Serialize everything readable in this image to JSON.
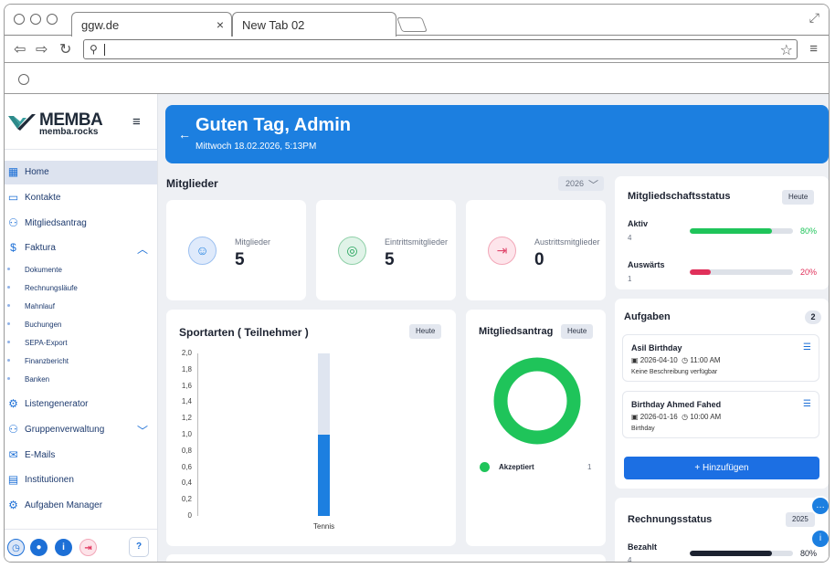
{
  "browser": {
    "tabs": [
      {
        "label": "ggw.de",
        "close": "×"
      },
      {
        "label": "New Tab 02"
      }
    ],
    "url": ""
  },
  "sidebar": {
    "logo_name": "MEMBA",
    "logo_sub": "memba.rocks",
    "items": [
      {
        "label": "Home",
        "icon": "grid-icon"
      },
      {
        "label": "Kontakte",
        "icon": "contact-card-icon"
      },
      {
        "label": "Mitgliedsantrag",
        "icon": "user-add-icon"
      },
      {
        "label": "Faktura",
        "icon": "dollar-icon"
      },
      {
        "label": "Listengenerator",
        "icon": "list-generator-icon"
      },
      {
        "label": "Gruppenverwaltung",
        "icon": "group-icon"
      },
      {
        "label": "E-Mails",
        "icon": "mail-icon"
      },
      {
        "label": "Institutionen",
        "icon": "institution-icon"
      },
      {
        "label": "Aufgaben Manager",
        "icon": "gear-icon"
      }
    ],
    "faktura_sub": [
      "Dokumente",
      "Rechnungsläufe",
      "Mahnlauf",
      "Buchungen",
      "SEPA-Export",
      "Finanzbericht",
      "Banken"
    ]
  },
  "header": {
    "title": "Guten Tag, Admin",
    "date": "Mittwoch 18.02.2026, 5:13PM"
  },
  "mitglieder": {
    "title": "Mitglieder",
    "year": "2026",
    "stats": [
      {
        "label": "Mitglieder",
        "value": "5",
        "color": "#1c7fe0"
      },
      {
        "label": "Eintrittsmitglieder",
        "value": "5",
        "color": "#22a35a"
      },
      {
        "label": "Austrittsmitglieder",
        "value": "0",
        "color": "#e0446a"
      }
    ]
  },
  "sportarten": {
    "title": "Sportarten ( Teilnehmer )",
    "filter": "Heute"
  },
  "chart_data": {
    "type": "bar",
    "categories": [
      "Tennis"
    ],
    "values": [
      1
    ],
    "title": "Sportarten ( Teilnehmer )",
    "xlabel": "",
    "ylabel": "",
    "ylim": [
      0,
      2
    ],
    "yticks": [
      "0",
      "0,2",
      "0,4",
      "0,6",
      "0,8",
      "1,0",
      "1,2",
      "1,4",
      "1,6",
      "1,8",
      "2,0"
    ]
  },
  "antrag": {
    "title": "Mitgliedsantrag",
    "filter": "Heute",
    "legend_label": "Akzeptiert",
    "legend_count": "1",
    "color": "#1fc45a"
  },
  "status": {
    "title": "Mitgliedschaftsstatus",
    "filter": "Heute",
    "rows": [
      {
        "label": "Aktiv",
        "count": "4",
        "pct": "80%",
        "value": 80,
        "color": "#1fc45a"
      },
      {
        "label": "Auswärts",
        "count": "1",
        "pct": "20%",
        "value": 20,
        "color": "#e0305a"
      }
    ]
  },
  "aufgaben": {
    "title": "Aufgaben",
    "count": "2",
    "tasks": [
      {
        "title": "Asil Birthday",
        "date": "2026-04-10",
        "time": "11:00 AM",
        "desc": "Keine Beschreibung verfügbar"
      },
      {
        "title": "Birthday Ahmed Fahed",
        "date": "2026-01-16",
        "time": "10:00 AM",
        "desc": "Birthday"
      }
    ],
    "add_label": "Hinzufügen"
  },
  "rechnung": {
    "title": "Rechnungsstatus",
    "year": "2025",
    "row": {
      "label": "Bezahlt",
      "count": "4",
      "pct": "80%",
      "value": 80,
      "color": "#1c2230"
    }
  }
}
